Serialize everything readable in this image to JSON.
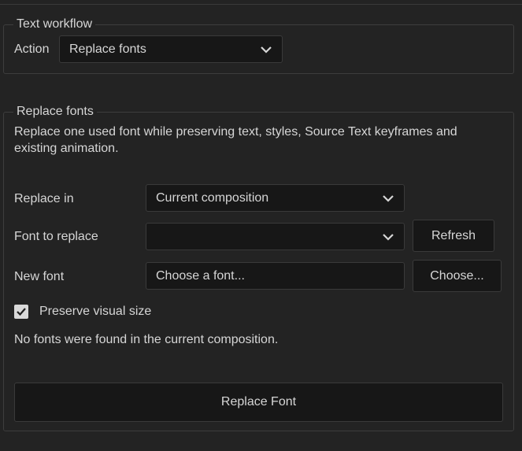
{
  "workflow": {
    "legend": "Text workflow",
    "action_label": "Action",
    "action_value": "Replace fonts"
  },
  "replace": {
    "legend": "Replace fonts",
    "description": "Replace one used font while preserving text, styles, Source Text keyframes and existing animation.",
    "replace_in_label": "Replace in",
    "replace_in_value": "Current composition",
    "font_to_replace_label": "Font to replace",
    "font_to_replace_value": "",
    "refresh_button": "Refresh",
    "new_font_label": "New font",
    "new_font_value": "Choose a font...",
    "choose_button": "Choose...",
    "preserve_label": "Preserve visual size",
    "preserve_checked": true,
    "status_message": "No fonts were found in the current composition.",
    "replace_button": "Replace Font"
  },
  "icons": {
    "dropdown": "chevron-down-icon",
    "check": "check-icon"
  }
}
